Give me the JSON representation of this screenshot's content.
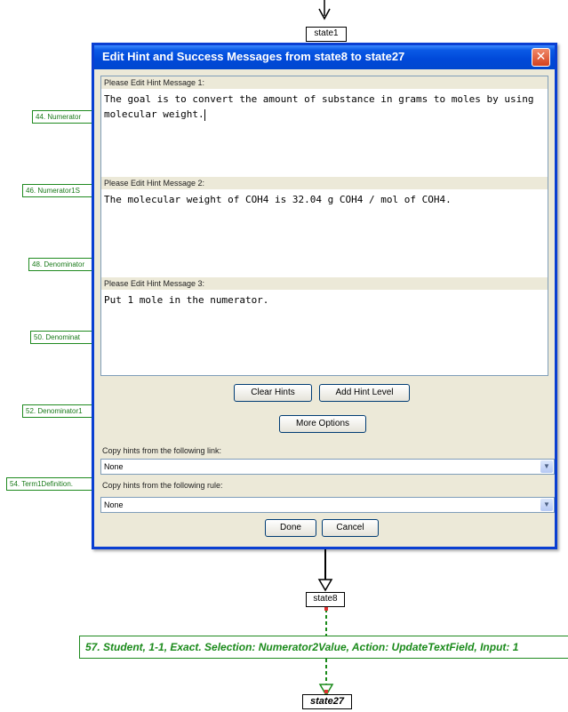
{
  "graph": {
    "top_state": "state1",
    "mid_state": "state8",
    "bottom_state": "state27",
    "edge_labels": [
      "44. Numerator",
      "46. Numerator1S",
      "48. Denominator",
      "50. Denominat",
      "52. Denominator1",
      "54. Term1Definition."
    ],
    "main_edge": "57. Student, 1-1, Exact. Selection: Numerator2Value, Action: UpdateTextField, Input: 1"
  },
  "dialog": {
    "title": "Edit Hint and Success Messages from state8 to state27",
    "hints": [
      {
        "label": "Please Edit Hint Message 1:",
        "text": "The goal is to convert the amount of substance in grams to moles by using molecular weight."
      },
      {
        "label": "Please Edit Hint Message 2:",
        "text": "The molecular weight of COH4 is 32.04 g COH4 / mol of COH4."
      },
      {
        "label": "Please Edit Hint Message 3:",
        "text": "Put 1 mole in the numerator."
      }
    ],
    "buttons": {
      "clear_hints": "Clear Hints",
      "add_hint_level": "Add Hint Level",
      "more_options": "More Options",
      "done": "Done",
      "cancel": "Cancel"
    },
    "copy_link_label": "Copy hints from the following link:",
    "copy_link_value": "None",
    "copy_rule_label": "Copy hints from the following rule:",
    "copy_rule_value": "None"
  },
  "colors": {
    "titlebar": "#0048d8",
    "edge_green": "#1a8a1a",
    "dialog_face": "#ece9d8"
  }
}
